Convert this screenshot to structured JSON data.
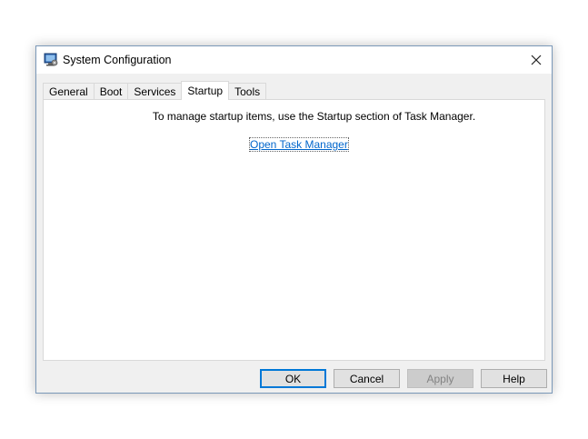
{
  "window": {
    "title": "System Configuration",
    "app_icon": "system-configuration-icon",
    "close_icon": "close-icon"
  },
  "tabs": [
    {
      "label": "General"
    },
    {
      "label": "Boot"
    },
    {
      "label": "Services"
    },
    {
      "label": "Startup",
      "active": true
    },
    {
      "label": "Tools"
    }
  ],
  "startup": {
    "info_text": "To manage startup items, use the Startup section of Task Manager.",
    "link_text": "Open Task Manager"
  },
  "buttons": {
    "ok": "OK",
    "cancel": "Cancel",
    "apply": "Apply",
    "help": "Help"
  },
  "colors": {
    "link": "#0066cc",
    "default_button_border": "#0078d7",
    "window_border": "#7a98b8"
  }
}
